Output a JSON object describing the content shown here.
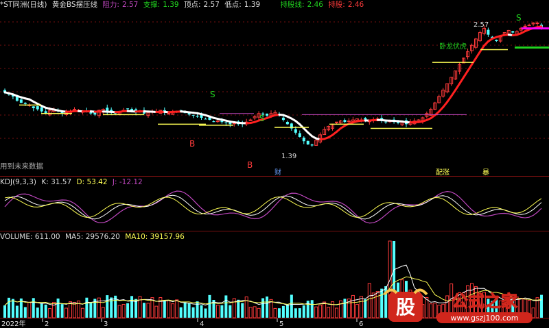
{
  "title": "*ST同洲(日线)",
  "indicator_name": "黄金BS摆压线",
  "header": {
    "pressure_label": "顶点:",
    "pressure_value": "2.57",
    "support_label": "低点:",
    "support_value": "1.39",
    "resist_label": "阻力:",
    "resist_value": "2.57",
    "low_label": "支撑:",
    "low_value": "1.39",
    "hold_label": "持股线:",
    "hold_value": "2.46",
    "hold2_label": "持股:",
    "hold2_value": "2.46"
  },
  "future_note": "用到未来数据",
  "annotations": {
    "price_high": "2.57",
    "price_low": "1.39",
    "dragon_text": "卧龙伏虎",
    "b_marker": "B",
    "s_marker": "S",
    "event_tags": [
      "财",
      "配涨",
      "暴"
    ]
  },
  "kdj": {
    "title": "KDJ(9,3,3)",
    "k": "K: 31.57",
    "d": "D: 53.42",
    "j": "J: -12.12"
  },
  "volume": {
    "title": "VOLUME: 611.00",
    "ma5": "MA5: 29576.20",
    "ma10": "MA10: 39157.96"
  },
  "axis": {
    "year_label": "2022年",
    "month_labels": [
      "2",
      "3",
      "4",
      "5",
      "6"
    ]
  },
  "watermark": {
    "logo_text": "股",
    "brand": "公式之家",
    "url": "www.gszj100.com"
  },
  "colors": {
    "up": "#ff3b3b",
    "down": "#54ffff",
    "line_white": "#ffffff",
    "line_red": "#ff2020",
    "green": "#21d21f",
    "yellow": "#ffff55",
    "purple": "#c048c0",
    "grid": "#7a1010"
  },
  "chart_data": {
    "type": "candlestick",
    "price_ylim": [
      1.3,
      2.65
    ],
    "closes": [
      1.9,
      1.88,
      1.86,
      1.82,
      1.8,
      1.79,
      1.78,
      1.75,
      1.74,
      1.72,
      1.7,
      1.73,
      1.74,
      1.72,
      1.7,
      1.71,
      1.72,
      1.74,
      1.73,
      1.72,
      1.72,
      1.7,
      1.69,
      1.73,
      1.74,
      1.72,
      1.71,
      1.7,
      1.72,
      1.73,
      1.74,
      1.72,
      1.71,
      1.72,
      1.7,
      1.71,
      1.72,
      1.72,
      1.73,
      1.71,
      1.7,
      1.72,
      1.72,
      1.73,
      1.71,
      1.69,
      1.68,
      1.67,
      1.66,
      1.65,
      1.64,
      1.62,
      1.63,
      1.62,
      1.61,
      1.6,
      1.61,
      1.6,
      1.6,
      1.62,
      1.64,
      1.67,
      1.7,
      1.69,
      1.68,
      1.7,
      1.71,
      1.68,
      1.64,
      1.6,
      1.56,
      1.52,
      1.48,
      1.44,
      1.41,
      1.4,
      1.45,
      1.5,
      1.55,
      1.58,
      1.6,
      1.62,
      1.63,
      1.62,
      1.63,
      1.64,
      1.65,
      1.64,
      1.63,
      1.63,
      1.64,
      1.65,
      1.63,
      1.62,
      1.63,
      1.62,
      1.61,
      1.62,
      1.6,
      1.62,
      1.63,
      1.64,
      1.66,
      1.7,
      1.74,
      1.8,
      1.86,
      1.92,
      1.98,
      2.04,
      2.1,
      2.16,
      2.22,
      2.28,
      2.34,
      2.4,
      2.46,
      2.5,
      2.44,
      2.4,
      2.38,
      2.42,
      2.46,
      2.48,
      2.46,
      2.47,
      2.5,
      2.52,
      2.53,
      2.55,
      2.55,
      2.5
    ],
    "kdj": {
      "k_last": 31.57,
      "d_last": 53.42,
      "j_last": -12.12
    },
    "volume": {
      "last": 611.0,
      "ma5": 29576.2,
      "ma10": 39157.96
    }
  }
}
